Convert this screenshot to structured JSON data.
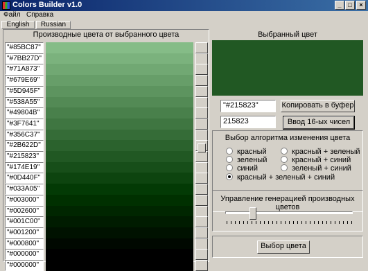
{
  "window": {
    "title": "Colors Builder v1.0",
    "minimize_label": "_",
    "maximize_label": "□",
    "close_label": "×"
  },
  "menu": {
    "items": [
      {
        "label": "Файл"
      },
      {
        "label": "Справка"
      }
    ]
  },
  "language_tabs": [
    {
      "label": "English"
    },
    {
      "label": "Russian"
    }
  ],
  "derived_panel": {
    "header": "Производные цвета от выбранного цвета",
    "rows": [
      {
        "label": "\"#85BC87\"",
        "color": "#85BC87"
      },
      {
        "label": "\"#7BB27D\"",
        "color": "#7BB27D"
      },
      {
        "label": "\"#71A873\"",
        "color": "#71A873"
      },
      {
        "label": "\"#679E69\"",
        "color": "#679E69"
      },
      {
        "label": "\"#5D945F\"",
        "color": "#5D945F"
      },
      {
        "label": "\"#538A55\"",
        "color": "#538A55"
      },
      {
        "label": "\"#49804B\"",
        "color": "#49804B"
      },
      {
        "label": "\"#3F7641\"",
        "color": "#3F7641"
      },
      {
        "label": "\"#356C37\"",
        "color": "#356C37"
      },
      {
        "label": "\"#2B622D\"",
        "color": "#2B622D"
      },
      {
        "label": "\"#215823\"",
        "color": "#215823"
      },
      {
        "label": "\"#174E19\"",
        "color": "#174E19"
      },
      {
        "label": "\"#0D440F\"",
        "color": "#0D440F"
      },
      {
        "label": "\"#033A05\"",
        "color": "#033A05"
      },
      {
        "label": "\"#003000\"",
        "color": "#003000"
      },
      {
        "label": "\"#002600\"",
        "color": "#002600"
      },
      {
        "label": "\"#001C00\"",
        "color": "#001C00"
      },
      {
        "label": "\"#001200\"",
        "color": "#001200"
      },
      {
        "label": "\"#000800\"",
        "color": "#000800"
      },
      {
        "label": "\"#000000\"",
        "color": "#000000"
      },
      {
        "label": "\"#000000\"",
        "color": "#000000"
      }
    ]
  },
  "selected_panel": {
    "header": "Выбранный цвет",
    "color": "#215823",
    "hex_string_value": "\"#215823\"",
    "copy_button_label": "Копировать в буфер",
    "hex_number_value": "215823",
    "enter_hex_button_label": "Ввод 16-ых чисел"
  },
  "algorithm_group": {
    "title": "Выбор алгоритма изменения цвета",
    "options": [
      {
        "label": "красный",
        "selected": false
      },
      {
        "label": "красный + зеленый",
        "selected": false
      },
      {
        "label": "зеленый",
        "selected": false
      },
      {
        "label": "красный + синий",
        "selected": false
      },
      {
        "label": "синий",
        "selected": false
      },
      {
        "label": "зеленый + синий",
        "selected": false
      },
      {
        "label": "красный + зеленый + синий",
        "selected": true
      }
    ]
  },
  "generation_group": {
    "title": "Управление генерацией производных цветов",
    "slider_level": 0.2
  },
  "choose_color_button_label": "Выбор цвета"
}
